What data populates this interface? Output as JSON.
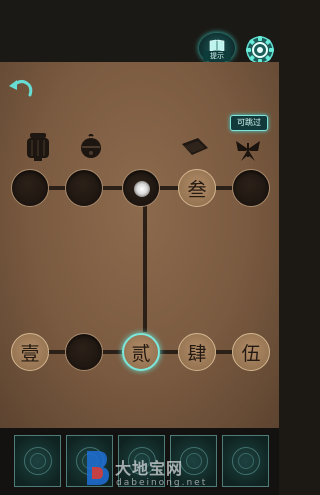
{
  "top_bar": {
    "hint_label": "提示",
    "hint_icon": "book-icon",
    "settings_icon": "gear-icon"
  },
  "game": {
    "back_icon": "back-arrow-icon",
    "skip_label": "可跳过",
    "items": [
      "lantern-icon",
      "bell-icon",
      "book-icon",
      "butterfly-icon"
    ],
    "top_row": [
      {
        "kind": "empty"
      },
      {
        "kind": "empty"
      },
      {
        "kind": "glow"
      },
      {
        "kind": "piece",
        "label": "叁"
      },
      {
        "kind": "empty"
      }
    ],
    "bottom_row": [
      {
        "kind": "piece",
        "label": "壹"
      },
      {
        "kind": "empty"
      },
      {
        "kind": "piece",
        "label": "贰",
        "selected": true
      },
      {
        "kind": "piece",
        "label": "肆"
      },
      {
        "kind": "piece",
        "label": "伍"
      }
    ]
  },
  "inventory": {
    "slot_count": 5
  },
  "watermark": {
    "text": "大地宝网",
    "url": "dabeinong.net"
  },
  "colors": {
    "accent": "#7de8dc",
    "panel": "#7a5a40",
    "slot": "#1d1510"
  }
}
